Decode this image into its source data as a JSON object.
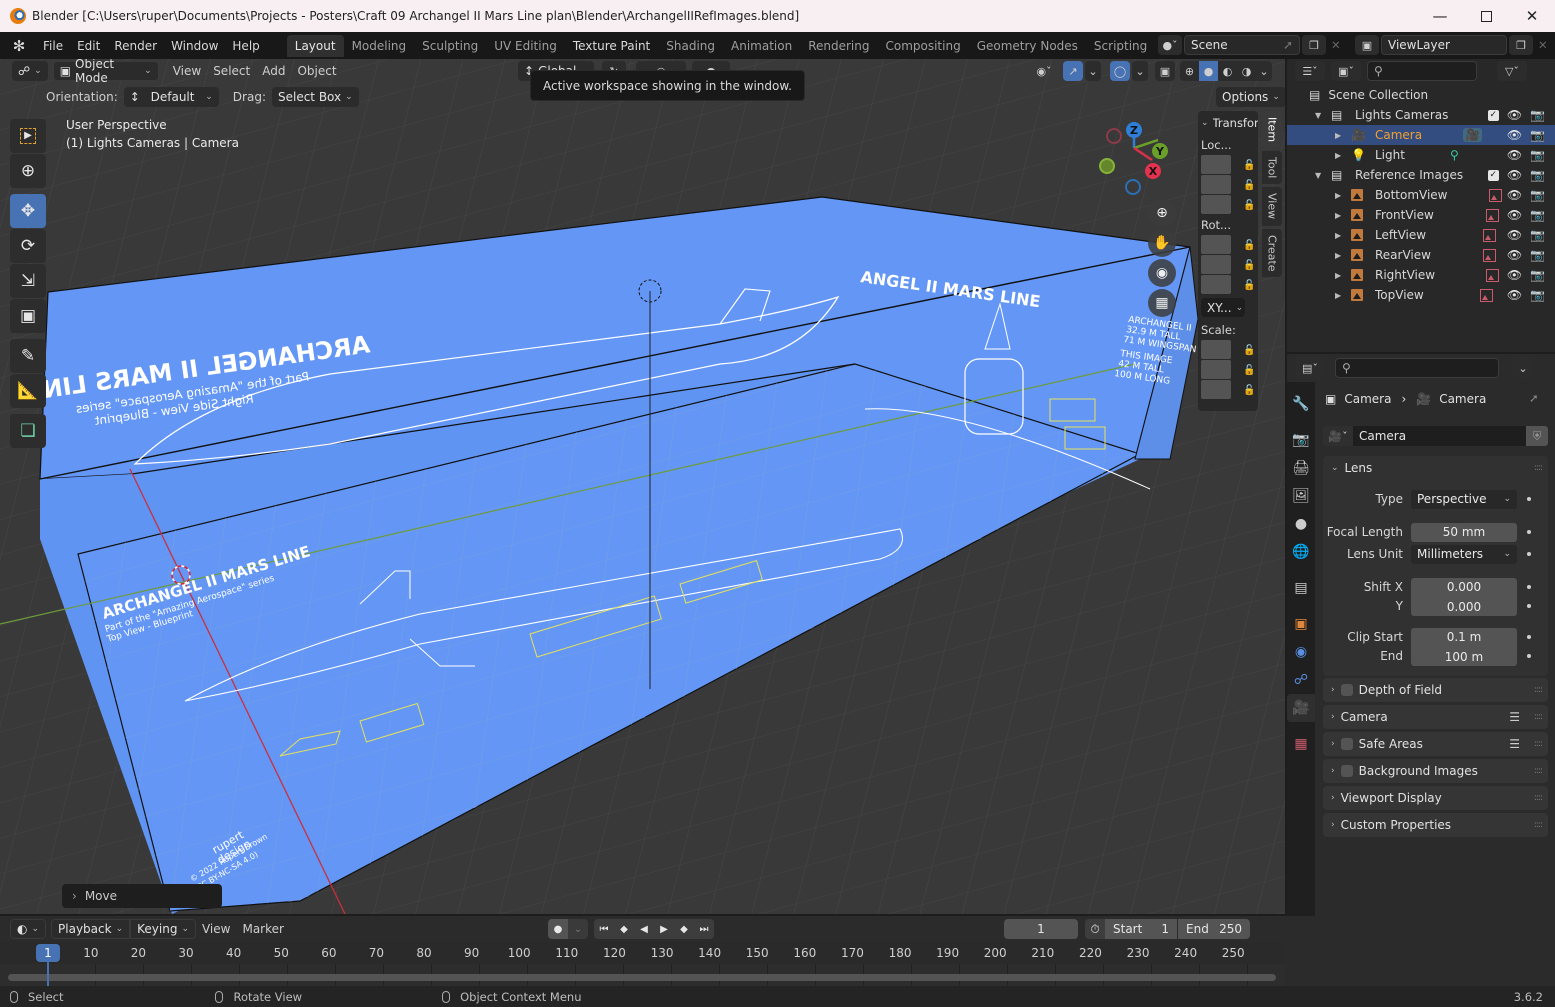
{
  "window": {
    "title": "Blender [C:\\Users\\ruper\\Documents\\Projects - Posters\\Craft 09 Archangel II Mars Line plan\\Blender\\ArchangelIIRefImages.blend]",
    "minimize_icon": "minimize-icon",
    "maximize_icon": "maximize-icon",
    "close_icon": "close-icon"
  },
  "menubar": {
    "menus": [
      "File",
      "Edit",
      "Render",
      "Window",
      "Help"
    ],
    "workspaces": [
      "Layout",
      "Modeling",
      "Sculpting",
      "UV Editing",
      "Texture Paint",
      "Shading",
      "Animation",
      "Rendering",
      "Compositing",
      "Geometry Nodes",
      "Scripting"
    ],
    "active_workspace": "Layout",
    "hovered_workspace": "Texture Paint",
    "add_workspace": "+",
    "scene": "Scene",
    "view_layer": "ViewLayer"
  },
  "viewport": {
    "mode": "Object Mode",
    "menus": [
      "View",
      "Select",
      "Add",
      "Object"
    ],
    "transform_orientation": "Global",
    "orientation_label": "Orientation:",
    "orientation_value": "Default",
    "drag_label": "Drag:",
    "drag_value": "Select Box",
    "options_label": "Options",
    "view_name": "User Perspective",
    "view_context": "(1) Lights Cameras | Camera",
    "tooltip": "Active workspace showing in the window.",
    "last_operator": "Move",
    "gizmo_axes": [
      "X",
      "Y",
      "Z"
    ],
    "blueprint": {
      "side_title": "ARCHANGEL II MARS LINE",
      "side_sub1": "Part of the \"Amazing Aerospace\" series",
      "side_sub2": "Right Side View - Blueprint",
      "top_title": "ARCHANGEL II MARS LINE",
      "top_sub1": "Part of the \"Amazing Aerospace\" series",
      "top_sub2": "Top View - Blueprint",
      "front_title": "ANGEL II MARS LINE",
      "front_stats": [
        "ARCHANGEL II",
        "32.9 M TALL",
        "71 M WINGSPAN",
        "THIS IMAGE",
        "42 M TALL",
        "100 M LONG"
      ],
      "brand1": "rupert",
      "brand2": "design",
      "copyright1": "© 2022 Rupert Brown",
      "copyright2": "(CC BY-NC-SA 4.0)"
    }
  },
  "npanel": {
    "section": "Transform",
    "location_label": "Loc...",
    "rotation_label": "Rot...",
    "rotation_mode": "XY...",
    "scale_label": "Scale:",
    "tabs": [
      "Item",
      "Tool",
      "View",
      "Create"
    ],
    "active_tab": "Item"
  },
  "outliner": {
    "search_placeholder": "",
    "root": "Scene Collection",
    "rows": [
      {
        "label": "Lights Cameras",
        "type": "collection",
        "level": 1,
        "checked": true
      },
      {
        "label": "Camera",
        "type": "camera",
        "level": 2,
        "selected": true
      },
      {
        "label": "Light",
        "type": "light",
        "level": 2
      },
      {
        "label": "Reference Images",
        "type": "collection",
        "level": 1,
        "checked": true
      },
      {
        "label": "BottomView",
        "type": "image",
        "level": 2
      },
      {
        "label": "FrontView",
        "type": "image",
        "level": 2
      },
      {
        "label": "LeftView",
        "type": "image",
        "level": 2
      },
      {
        "label": "RearView",
        "type": "image",
        "level": 2
      },
      {
        "label": "RightView",
        "type": "image",
        "level": 2
      },
      {
        "label": "TopView",
        "type": "image",
        "level": 2
      }
    ]
  },
  "properties": {
    "breadcrumb_object": "Camera",
    "breadcrumb_data": "Camera",
    "datablock_name": "Camera",
    "lens_panel": "Lens",
    "type_label": "Type",
    "type_value": "Perspective",
    "focal_label": "Focal Length",
    "focal_value": "50 mm",
    "lens_unit_label": "Lens Unit",
    "lens_unit_value": "Millimeters",
    "shift_x_label": "Shift X",
    "shift_x_value": "0.000",
    "shift_y_label": "Y",
    "shift_y_value": "0.000",
    "clip_start_label": "Clip Start",
    "clip_start_value": "0.1 m",
    "clip_end_label": "End",
    "clip_end_value": "100 m",
    "collapsed_panels": [
      {
        "label": "Depth of Field",
        "checkbox": true,
        "presets": false
      },
      {
        "label": "Camera",
        "checkbox": false,
        "presets": true
      },
      {
        "label": "Safe Areas",
        "checkbox": true,
        "presets": true
      },
      {
        "label": "Background Images",
        "checkbox": true,
        "presets": false
      },
      {
        "label": "Viewport Display",
        "checkbox": false,
        "presets": false
      },
      {
        "label": "Custom Properties",
        "checkbox": false,
        "presets": false
      }
    ],
    "tabs": [
      "tool",
      "render",
      "output",
      "view-layer",
      "scene",
      "world",
      "collection",
      "object",
      "modifiers",
      "physics",
      "object-data-camera",
      "texture"
    ],
    "active_tab": "object-data-camera"
  },
  "timeline": {
    "menus": [
      "Playback",
      "Keying",
      "View",
      "Marker"
    ],
    "current_frame": "1",
    "start_label": "Start",
    "start_value": "1",
    "end_label": "End",
    "end_value": "250",
    "ruler_ticks": [
      "10",
      "20",
      "30",
      "40",
      "50",
      "60",
      "70",
      "80",
      "90",
      "100",
      "110",
      "120",
      "130",
      "140",
      "150",
      "160",
      "170",
      "180",
      "190",
      "200",
      "210",
      "220",
      "230",
      "240",
      "250"
    ],
    "playhead": "1"
  },
  "statusbar": {
    "left_click": "Select",
    "middle_click": "Rotate View",
    "right_click": "Object Context Menu",
    "version": "3.6.2"
  }
}
